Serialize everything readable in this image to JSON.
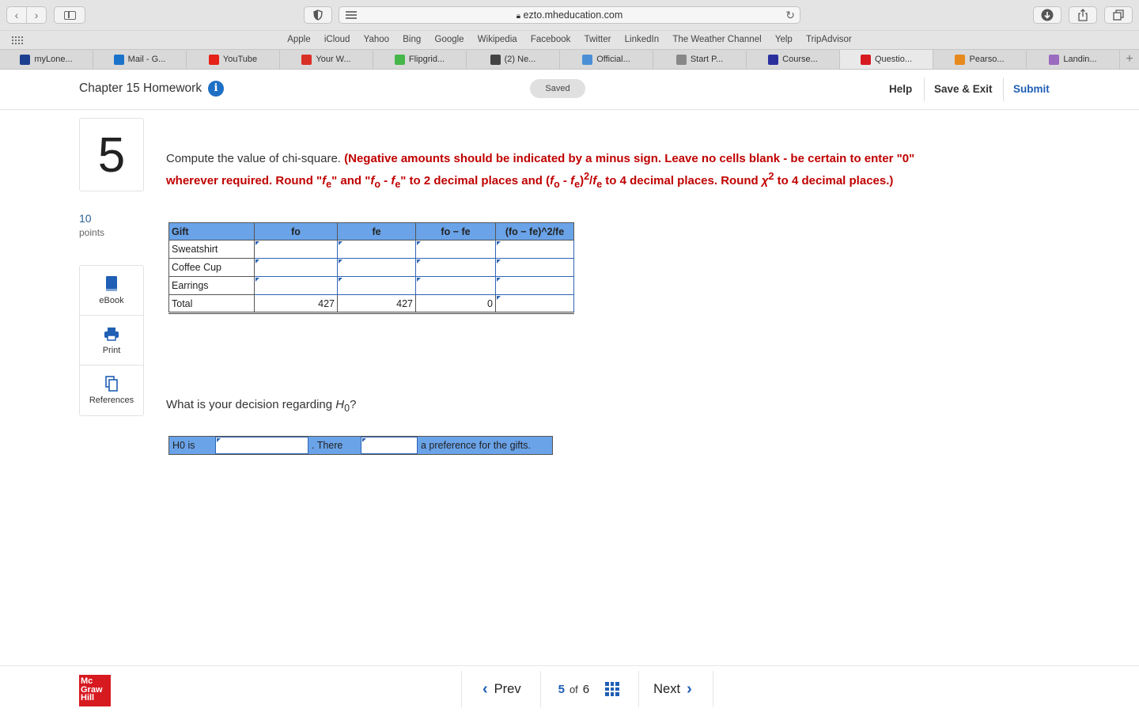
{
  "browser": {
    "url": "ezto.mheducation.com",
    "favorites": [
      "Apple",
      "iCloud",
      "Yahoo",
      "Bing",
      "Google",
      "Wikipedia",
      "Facebook",
      "Twitter",
      "LinkedIn",
      "The Weather Channel",
      "Yelp",
      "TripAdvisor"
    ],
    "tabs": [
      {
        "label": "myLone...",
        "color": "#1d3f8f"
      },
      {
        "label": "Mail - G...",
        "color": "#1a73c8"
      },
      {
        "label": "YouTube",
        "color": "#e62117"
      },
      {
        "label": "Your W...",
        "color": "#d93025"
      },
      {
        "label": "Flipgrid...",
        "color": "#45b649"
      },
      {
        "label": "(2) Ne...",
        "color": "#444444"
      },
      {
        "label": "Official...",
        "color": "#4a8fd6"
      },
      {
        "label": "Start P...",
        "color": "#888888"
      },
      {
        "label": "Course...",
        "color": "#2b2f9e"
      },
      {
        "label": "Questio...",
        "color": "#d71920"
      },
      {
        "label": "Pearso...",
        "color": "#e68a1e"
      },
      {
        "label": "Landin...",
        "color": "#9b6bbf"
      }
    ],
    "active_tab": 9
  },
  "header": {
    "title": "Chapter 15 Homework",
    "saved": "Saved",
    "help": "Help",
    "save_exit": "Save & Exit",
    "submit": "Submit"
  },
  "question": {
    "number": "5",
    "points": "10",
    "points_label": "points",
    "tools": {
      "ebook": "eBook",
      "print": "Print",
      "references": "References"
    },
    "intro": "Compute the value of chi-square.",
    "instructions_parts": [
      "(Negative amounts should be indicated by a minus sign. Leave no cells blank - be certain to enter \"0\" wherever required. Round \"",
      "f",
      "e",
      "\" and \"",
      "f",
      "o",
      " - ",
      "f",
      "e",
      "\" to 2 decimal places and (",
      "f",
      "o",
      " - ",
      "f",
      "e",
      ")",
      "2",
      "/",
      "f",
      "e",
      " to 4 decimal places. Round ",
      "χ",
      "2",
      " to 4 decimal places.)"
    ],
    "table": {
      "headers": [
        "Gift",
        "fo",
        "fe",
        "fo − fe",
        "(fo − fe)^2/fe"
      ],
      "rows": [
        {
          "label": "Sweatshirt"
        },
        {
          "label": "Coffee Cup"
        },
        {
          "label": "Earrings"
        }
      ],
      "total": {
        "label": "Total",
        "fo": "427",
        "fe": "427",
        "diff": "0"
      }
    },
    "decision_question_prefix": "What is your decision regarding ",
    "decision_question_var": "H",
    "decision_question_sub": "0",
    "decision_question_suffix": "?",
    "decision_parts": {
      "h0": "H0 is",
      "there": ". There",
      "tail": "a preference for the gifts."
    }
  },
  "footer": {
    "logo": [
      "Mc",
      "Graw",
      "Hill"
    ],
    "prev": "Prev",
    "current": "5",
    "of": "of",
    "total": "6",
    "next": "Next"
  }
}
